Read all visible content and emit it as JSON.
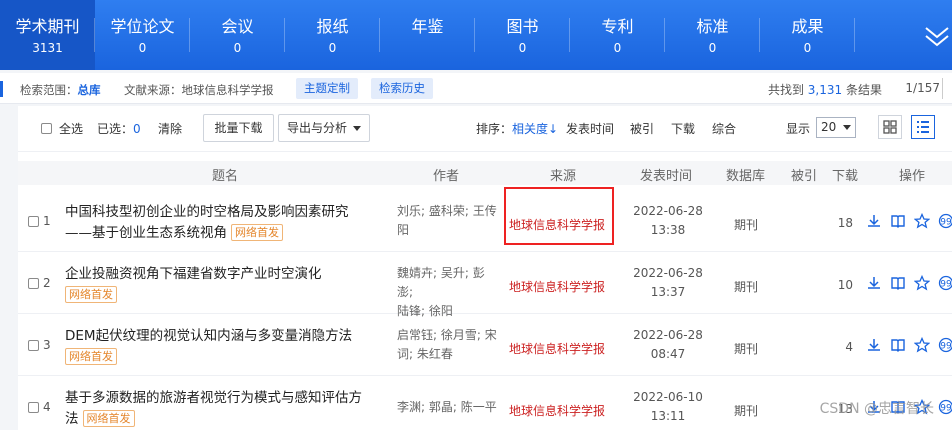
{
  "nav": {
    "items": [
      {
        "label": "学术期刊",
        "count": "3131"
      },
      {
        "label": "学位论文",
        "count": "0"
      },
      {
        "label": "会议",
        "count": "0"
      },
      {
        "label": "报纸",
        "count": "0"
      },
      {
        "label": "年鉴",
        "count": ""
      },
      {
        "label": "图书",
        "count": "0"
      },
      {
        "label": "专利",
        "count": "0"
      },
      {
        "label": "标准",
        "count": "0"
      },
      {
        "label": "成果",
        "count": "0"
      }
    ],
    "more_icon": "double-chevron-down-icon"
  },
  "info": {
    "scope_label": "检索范围：",
    "scope_value": "总库",
    "source_label": "文献来源：地球信息科学学报",
    "topic_btn": "主题定制",
    "history_btn": "检索历史",
    "found_pre": "共找到",
    "found_count": "3,131",
    "found_post": "条结果",
    "page": "1/157"
  },
  "toolbar": {
    "select_all": "全选",
    "selected_label": "已选：",
    "selected_count": "0",
    "clear": "清除",
    "batch_download": "批量下载",
    "export": "导出与分析",
    "sort_label": "排序：",
    "sort_relevance": "相关度",
    "sort_date": "发表时间",
    "sort_cited": "被引",
    "sort_download": "下载",
    "sort_composite": "综合",
    "show_label": "显示",
    "show_value": "20"
  },
  "table": {
    "headers": {
      "title": "题名",
      "author": "作者",
      "source": "来源",
      "date": "发表时间",
      "db": "数据库",
      "cited": "被引",
      "download": "下载",
      "ops": "操作"
    },
    "rows": [
      {
        "idx": "1",
        "title1": "中国科技型初创企业的时空格局及影响因素研究",
        "title2": "——基于创业生态系统视角",
        "badge": "网络首发",
        "authors1": "刘乐; 盛科荣; 王传",
        "authors2": "阳",
        "source": "地球信息科学学报",
        "date1": "2022-06-28",
        "date2": "13:38",
        "db": "期刊",
        "download": "18"
      },
      {
        "idx": "2",
        "title1": "企业投融资视角下福建省数字产业时空演化",
        "title2": "",
        "badge": "网络首发",
        "authors1": "魏婧卉; 吴升; 彭澎;",
        "authors2": "陆锋; 徐阳",
        "source": "地球信息科学学报",
        "date1": "2022-06-28",
        "date2": "13:37",
        "db": "期刊",
        "download": "10"
      },
      {
        "idx": "3",
        "title1": "DEM起伏纹理的视觉认知内涵与多变量消隐方法",
        "title2": "",
        "badge": "网络首发",
        "authors1": "启常钰; 徐月雪; 宋",
        "authors2": "词; 朱红春",
        "source": "地球信息科学学报",
        "date1": "2022-06-28",
        "date2": "08:47",
        "db": "期刊",
        "download": "4"
      },
      {
        "idx": "4",
        "title1": "基于多源数据的旅游者视觉行为模式与感知评估方",
        "title2": "法",
        "badge": "网络首发",
        "authors1": "李渊; 郭晶; 陈一平",
        "authors2": "",
        "source": "地球信息科学学报",
        "date1": "2022-06-10",
        "date2": "13:11",
        "db": "期刊",
        "download": "13"
      }
    ]
  },
  "watermark": "CSDN @忠言智长",
  "colors": {
    "brand": "#1a64de",
    "source_red": "#cc2222",
    "badge_orange": "#e4862c",
    "highlight": "#ee2222"
  }
}
